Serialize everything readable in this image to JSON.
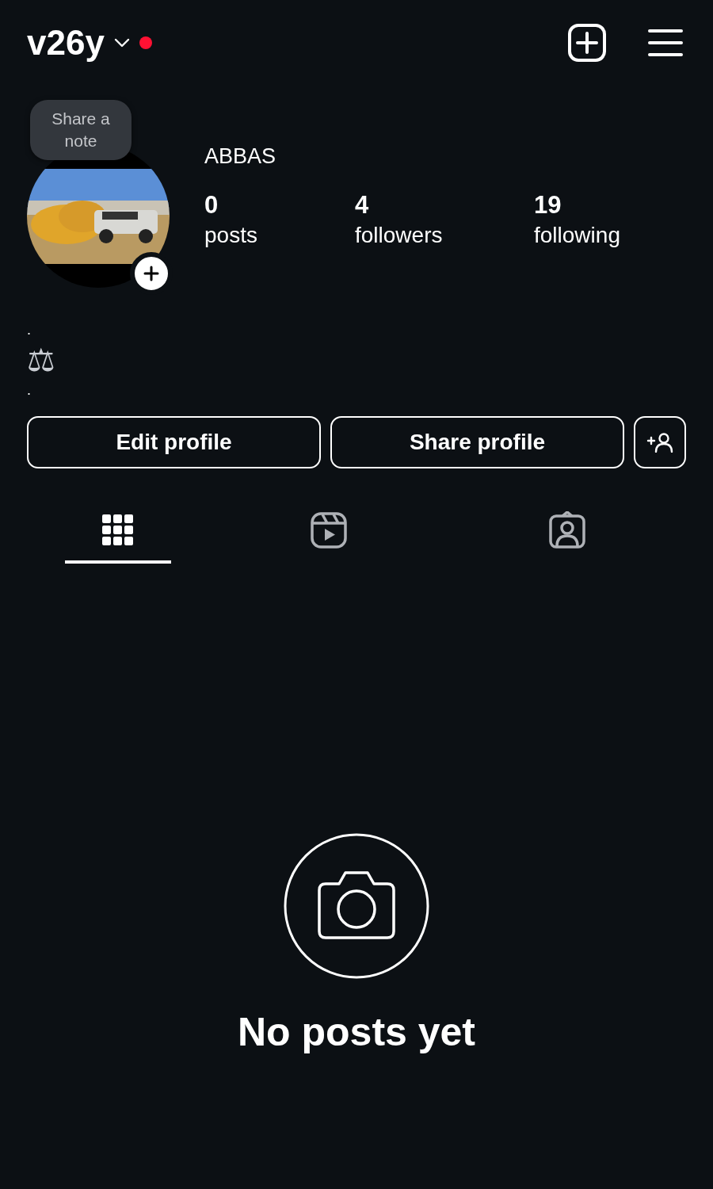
{
  "header": {
    "username": "v26y",
    "has_notification": true
  },
  "note_bubble": {
    "text": "Share a note"
  },
  "profile": {
    "name": "ABBAS"
  },
  "stats": [
    {
      "value": "0",
      "label": "posts"
    },
    {
      "value": "4",
      "label": "followers"
    },
    {
      "value": "19",
      "label": "following"
    }
  ],
  "bio": [
    ".",
    "⚖",
    "."
  ],
  "buttons": [
    "Edit profile",
    "Share profile"
  ],
  "tabs": [
    {
      "kind": "grid",
      "selected": true
    },
    {
      "kind": "reels",
      "selected": false
    },
    {
      "kind": "tagged",
      "selected": false
    }
  ],
  "empty_state": {
    "text": "No posts yet"
  }
}
